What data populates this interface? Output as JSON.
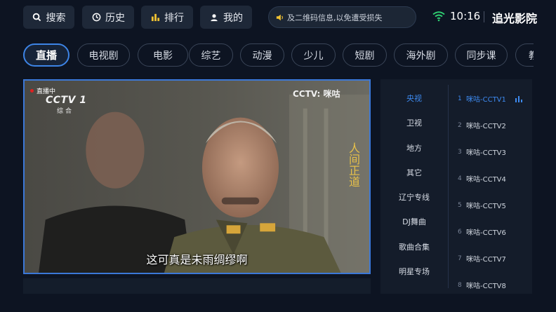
{
  "top_nav": [
    {
      "label": "搜索",
      "icon": "search-icon"
    },
    {
      "label": "历史",
      "icon": "history-icon"
    },
    {
      "label": "排行",
      "icon": "ranking-icon"
    },
    {
      "label": "我的",
      "icon": "user-icon"
    }
  ],
  "notice": {
    "text": "及二维码信息,以免遭受损失",
    "icon": "speaker-icon"
  },
  "status": {
    "time": "10:16",
    "wifi_icon": "wifi-icon",
    "wifi_color": "#2ecc71"
  },
  "app": {
    "title": "追光影院"
  },
  "categories": [
    "直播",
    "电视剧",
    "电影",
    "综艺",
    "动漫",
    "少儿",
    "短剧",
    "海外剧",
    "同步课",
    "教"
  ],
  "active_category": "直播",
  "player": {
    "live_label": "直播中",
    "channel_logo": "CCTV 1",
    "channel_sub": "综合",
    "watermark": "CCTV: 咪咕",
    "show_title": "人间正道",
    "subtitle": "这可真是未雨绸缪啊"
  },
  "groups": [
    "央视",
    "卫视",
    "地方",
    "其它",
    "辽宁专线",
    "DJ舞曲",
    "歌曲合集",
    "明星专场"
  ],
  "active_group": "央视",
  "channels": [
    {
      "num": "1",
      "name": "咪咕-CCTV1"
    },
    {
      "num": "2",
      "name": "咪咕-CCTV2"
    },
    {
      "num": "3",
      "name": "咪咕-CCTV3"
    },
    {
      "num": "4",
      "name": "咪咕-CCTV4"
    },
    {
      "num": "5",
      "name": "咪咕-CCTV5"
    },
    {
      "num": "6",
      "name": "咪咕-CCTV6"
    },
    {
      "num": "7",
      "name": "咪咕-CCTV7"
    },
    {
      "num": "8",
      "name": "咪咕-CCTV8"
    }
  ],
  "playing_icon": "equalizer-icon",
  "colors": {
    "accent": "#3d84e6",
    "background": "#0d1422",
    "live_dot": "#e02020"
  }
}
